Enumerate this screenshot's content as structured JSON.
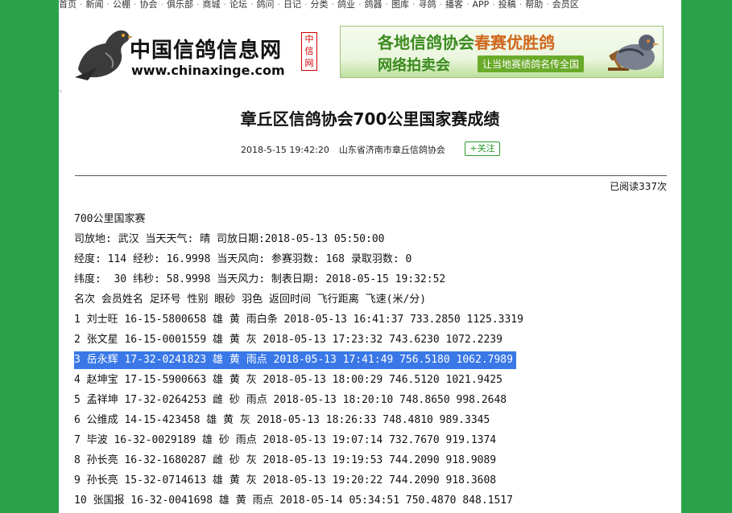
{
  "nav": [
    "首页",
    "新闻",
    "公棚",
    "协会",
    "俱乐部",
    "商城",
    "论坛",
    "鸽问",
    "日记",
    "分类",
    "鸽业",
    "鸽器",
    "图库",
    "寻鸽",
    "播客",
    "APP",
    "投稿",
    "帮助",
    "会员区"
  ],
  "logo": {
    "title": "中国信鸽信息网",
    "url": "www.chinaxinge.com"
  },
  "badge": "中信网",
  "ad": {
    "line1_a": "各地信鸽协会",
    "line1_b": "春赛优胜鸽",
    "line2": "网络拍卖会",
    "tag": "让当地赛绩鸽名传全国"
  },
  "article": {
    "title": "章丘区信鸽协会700公里国家赛成绩",
    "date": "2018-5-15 19:42:20",
    "source": "山东省济南市章丘信鸽协会",
    "follow_label": "+关注",
    "reads": "已阅读337次"
  },
  "content": {
    "lines": [
      "700公里国家赛",
      "司放地: 武汉 当天天气: 晴 司放日期:2018-05-13 05:50:00",
      "经度: 114 经秒: 16.9998 当天风向: 参赛羽数: 168 录取羽数: 0",
      "纬度:  30 纬秒: 58.9998 当天风力: 制表日期: 2018-05-15 19:32:52",
      "名次 会员姓名 足环号 性别 眼砂 羽色 返回时间 飞行距离 飞速(米/分)",
      "1 刘士旺 16-15-5800658 雄 黄 雨白条 2018-05-13 16:41:37 733.2850 1125.3319",
      "2 张文星 16-15-0001559 雄 黄 灰 2018-05-13 17:23:32 743.6230 1072.2239",
      "3 岳永辉 17-32-0241823 雄 黄 雨点 2018-05-13 17:41:49 756.5180 1062.7989",
      "4 赵坤宝 17-15-5900663 雄 黄 灰 2018-05-13 18:00:29 746.5120 1021.9425",
      "5 孟祥坤 17-32-0264253 雌 砂 雨点 2018-05-13 18:20:10 748.8650 998.2648",
      "6 公维成 14-15-423458 雄 黄 灰 2018-05-13 18:26:33 748.4810 989.3345",
      "7 毕波 16-32-0029189 雄 砂 雨点 2018-05-13 19:07:14 732.7670 919.1374",
      "8 孙长亮 16-32-1680287 雌 砂 灰 2018-05-13 19:19:53 744.2090 918.9089",
      "9 孙长亮 15-32-0714613 雄 黄 灰 2018-05-13 19:20:22 744.2090 918.3608",
      "10 张国报 16-32-0041698 雄 黄 雨点 2018-05-14 05:34:51 750.4870 848.1517"
    ],
    "selected_line": 7
  },
  "colors": {
    "background": "#2aa24a",
    "selection": "#3a78e8",
    "follow": "#2a9a2a",
    "badge": "#cc0000"
  }
}
